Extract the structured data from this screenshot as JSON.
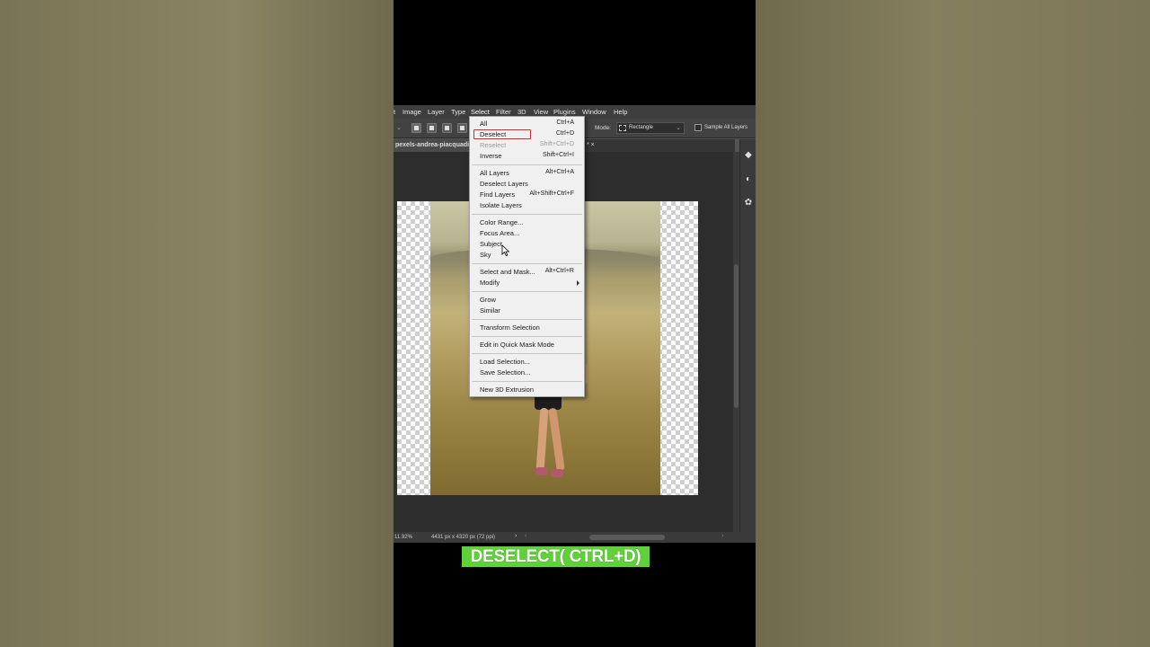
{
  "menubar": {
    "items": [
      "t",
      "Image",
      "Layer",
      "Type",
      "Select",
      "Filter",
      "3D",
      "View",
      "Plugins",
      "Window",
      "Help"
    ],
    "active": "Select"
  },
  "options": {
    "mode_label": "Mode:",
    "mode_value": "Rectangle",
    "sample_all_layers": "Sample All Layers"
  },
  "document": {
    "tab_title": "pexels-andrea-piacquadi",
    "tab_suffix": "* ×"
  },
  "status": {
    "zoom": "11.92%",
    "doc_info": "4431 px x 4320 px (72 ppi)"
  },
  "select_menu": {
    "items": [
      {
        "label": "All",
        "shortcut": "Ctrl+A",
        "enabled": true
      },
      {
        "label": "Deselect",
        "shortcut": "Ctrl+D",
        "enabled": true,
        "highlighted": true
      },
      {
        "label": "Reselect",
        "shortcut": "Shift+Ctrl+D",
        "enabled": false
      },
      {
        "label": "Inverse",
        "shortcut": "Shift+Ctrl+I",
        "enabled": true
      },
      {
        "label": "All Layers",
        "shortcut": "Alt+Ctrl+A",
        "enabled": true
      },
      {
        "label": "Deselect Layers",
        "shortcut": "",
        "enabled": true
      },
      {
        "label": "Find Layers",
        "shortcut": "Alt+Shift+Ctrl+F",
        "enabled": true
      },
      {
        "label": "Isolate Layers",
        "shortcut": "",
        "enabled": true
      },
      {
        "label": "Color Range...",
        "shortcut": "",
        "enabled": true
      },
      {
        "label": "Focus Area...",
        "shortcut": "",
        "enabled": true
      },
      {
        "label": "Subject",
        "shortcut": "",
        "enabled": true
      },
      {
        "label": "Sky",
        "shortcut": "",
        "enabled": true
      },
      {
        "label": "Select and Mask...",
        "shortcut": "Alt+Ctrl+R",
        "enabled": true
      },
      {
        "label": "Modify",
        "shortcut": "",
        "enabled": true,
        "submenu": true
      },
      {
        "label": "Grow",
        "shortcut": "",
        "enabled": true
      },
      {
        "label": "Similar",
        "shortcut": "",
        "enabled": true
      },
      {
        "label": "Transform Selection",
        "shortcut": "",
        "enabled": true
      },
      {
        "label": "Edit in Quick Mask Mode",
        "shortcut": "",
        "enabled": true
      },
      {
        "label": "Load Selection...",
        "shortcut": "",
        "enabled": true
      },
      {
        "label": "Save Selection...",
        "shortcut": "",
        "enabled": true
      },
      {
        "label": "New 3D Extrusion",
        "shortcut": "",
        "enabled": true
      }
    ]
  },
  "caption": {
    "text": "DESELECT( CTRL+D)",
    "color": "#5fd23a"
  },
  "icons": {
    "highlight_color": "#d8282c"
  }
}
